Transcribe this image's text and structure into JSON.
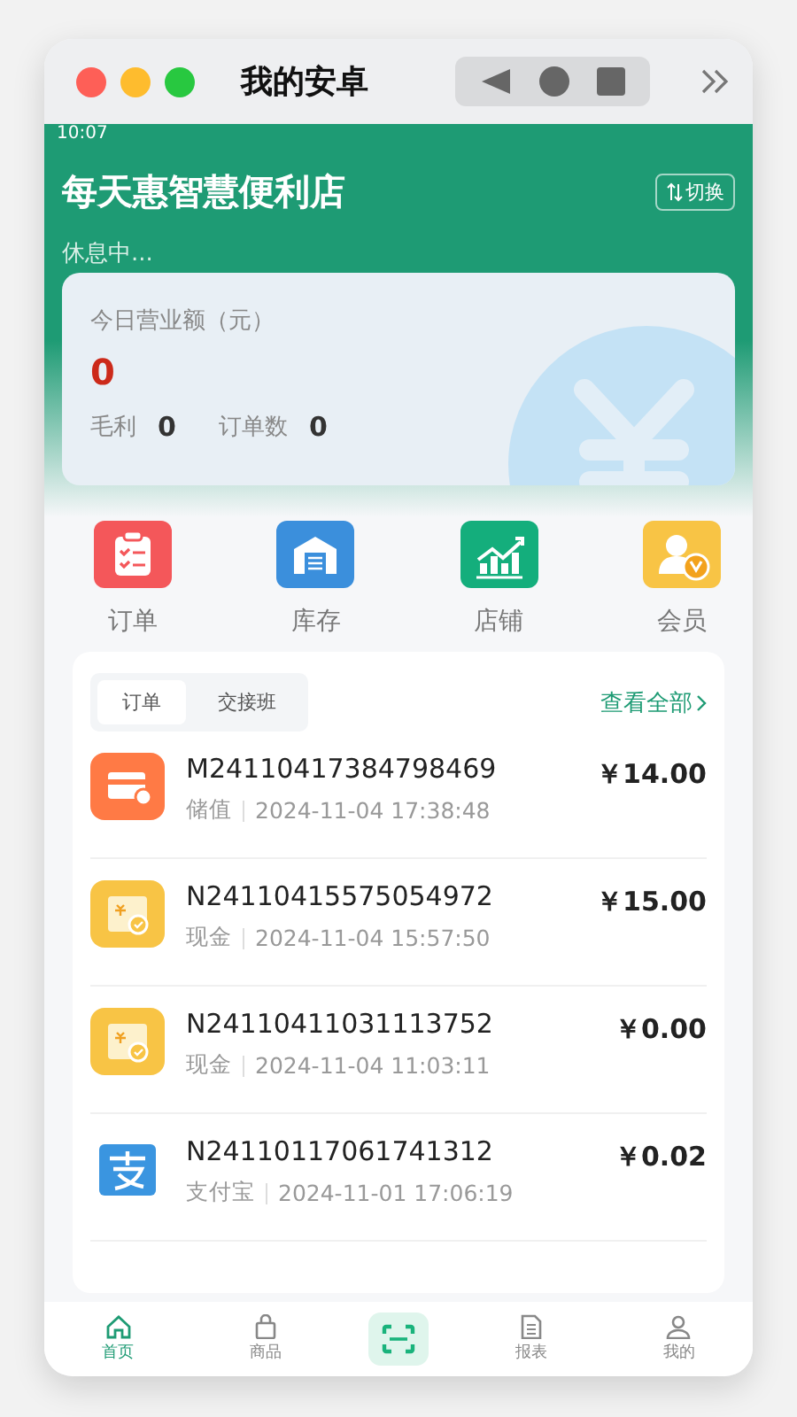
{
  "window": {
    "title": "我的安卓"
  },
  "status_bar": {
    "time": "10:07"
  },
  "store": {
    "name": "每天惠智慧便利店",
    "switch_label": "切换",
    "status": "休息中..."
  },
  "revenue": {
    "label": "今日营业额（元）",
    "value": "0",
    "stats": [
      {
        "label": "毛利",
        "value": "0"
      },
      {
        "label": "订单数",
        "value": "0"
      }
    ]
  },
  "shortcuts": [
    {
      "kind": "order",
      "label": "订单"
    },
    {
      "kind": "stock",
      "label": "库存"
    },
    {
      "kind": "shop",
      "label": "店铺"
    },
    {
      "kind": "member",
      "label": "会员"
    }
  ],
  "orders": {
    "tabs": [
      {
        "label": "订单",
        "selected": true
      },
      {
        "label": "交接班",
        "selected": false
      }
    ],
    "view_all": "查看全部",
    "rows": [
      {
        "kind": "stored_value",
        "number": "M24110417384798469",
        "method": "储值",
        "time": "2024-11-04 17:38:48",
        "amount": "￥14.00"
      },
      {
        "kind": "cash",
        "number": "N24110415575054972",
        "method": "现金",
        "time": "2024-11-04 15:57:50",
        "amount": "￥15.00"
      },
      {
        "kind": "cash",
        "number": "N24110411031113752",
        "method": "现金",
        "time": "2024-11-04 11:03:11",
        "amount": "￥0.00"
      },
      {
        "kind": "alipay",
        "number": "N24110117061741312",
        "method": "支付宝",
        "time": "2024-11-01 17:06:19",
        "amount": "￥0.02"
      }
    ]
  },
  "bottom_nav": [
    {
      "kind": "home",
      "label": "首页",
      "selected": true
    },
    {
      "kind": "goods",
      "label": "商品",
      "selected": false
    },
    {
      "kind": "scan",
      "selected": false
    },
    {
      "kind": "report",
      "label": "报表",
      "selected": false
    },
    {
      "kind": "me",
      "label": "我的",
      "selected": false
    }
  ]
}
